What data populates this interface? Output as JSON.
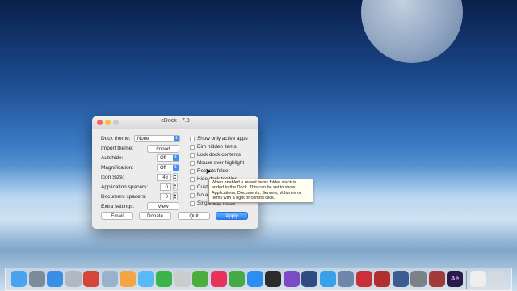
{
  "window": {
    "title": "cDock - 7.3"
  },
  "labels": {
    "dock_theme": "Dock theme:",
    "import_theme": "Import theme:",
    "autohide": "Autohide:",
    "magnification": "Magnification:",
    "icon_size": "Icon Size:",
    "application_spacers": "Application spacers:",
    "document_spacers": "Document spacers:",
    "extra_settings": "Extra settings:"
  },
  "controls": {
    "dock_theme_value": "None",
    "import_button": "Import",
    "autohide_value": "Off",
    "magnification_value": "Off",
    "icon_size_value": "46",
    "application_spacers_value": "0",
    "document_spacers_value": "0",
    "view_button": "View"
  },
  "checkboxes": [
    {
      "label": "Show only active apps",
      "checked": false
    },
    {
      "label": "Dim hidden items",
      "checked": false
    },
    {
      "label": "Lock dock contents",
      "checked": false
    },
    {
      "label": "Mouse over highlight",
      "checked": false
    },
    {
      "label": "Recents folder",
      "checked": false
    },
    {
      "label": "Hide dock tooltips",
      "checked": false
    },
    {
      "label": "Custom",
      "checked": false
    },
    {
      "label": "No ap",
      "checked": false
    },
    {
      "label": "Single app mode",
      "checked": false
    }
  ],
  "buttons": {
    "email": "Email",
    "donate": "Donate",
    "quit": "Quit",
    "apply": "Apply"
  },
  "tooltip": {
    "line1": "When enabled a recent items folder stack is",
    "line2": "added to the Dock. This can be set to show",
    "line3": "Applications, Documents, Servers, Volumes or",
    "line4": "Items with a right or control click."
  },
  "dock": {
    "icons": [
      {
        "name": "finder-icon",
        "color": "#4aa3f0"
      },
      {
        "name": "launchpad-icon",
        "color": "#7d8a99"
      },
      {
        "name": "safari-icon",
        "color": "#3a8ee6"
      },
      {
        "name": "dashboard-icon",
        "color": "#b0b8c2"
      },
      {
        "name": "chrome-icon",
        "color": "#d64536"
      },
      {
        "name": "photo-icon",
        "color": "#9ab2c9"
      },
      {
        "name": "photos-icon",
        "color": "#f2a540"
      },
      {
        "name": "messages-icon",
        "color": "#58b9f4"
      },
      {
        "name": "facetime-icon",
        "color": "#3bb44a"
      },
      {
        "name": "vlc-icon",
        "color": "#cccccc"
      },
      {
        "name": "utorrent-icon",
        "color": "#4eae3d"
      },
      {
        "name": "itunes-icon",
        "color": "#e8325a"
      },
      {
        "name": "evernote-icon",
        "color": "#47a945"
      },
      {
        "name": "appstore-icon",
        "color": "#2c8ef2"
      },
      {
        "name": "finalcut-icon",
        "color": "#2c2c2c"
      },
      {
        "name": "imovie-icon",
        "color": "#7a4bc4"
      },
      {
        "name": "quicktime-icon",
        "color": "#2f4c82"
      },
      {
        "name": "twitter-icon",
        "color": "#3aa0ea"
      },
      {
        "name": "preview-icon",
        "color": "#6d88a8"
      },
      {
        "name": "photobooth-icon",
        "color": "#c9303a"
      },
      {
        "name": "photoshop-icon",
        "color": "#b32f2f"
      },
      {
        "name": "keynote-icon",
        "color": "#3d5d91"
      },
      {
        "name": "sysprefs-icon",
        "color": "#7b8089"
      },
      {
        "name": "timemachine-icon",
        "color": "#a23a3a"
      },
      {
        "name": "aftereffects-icon",
        "color": "#2a1a4a"
      },
      {
        "name": "document-icon",
        "color": "#eeeeee"
      },
      {
        "name": "trash-icon",
        "color": "#d5dbe1"
      }
    ],
    "ae_text": "Ae"
  }
}
